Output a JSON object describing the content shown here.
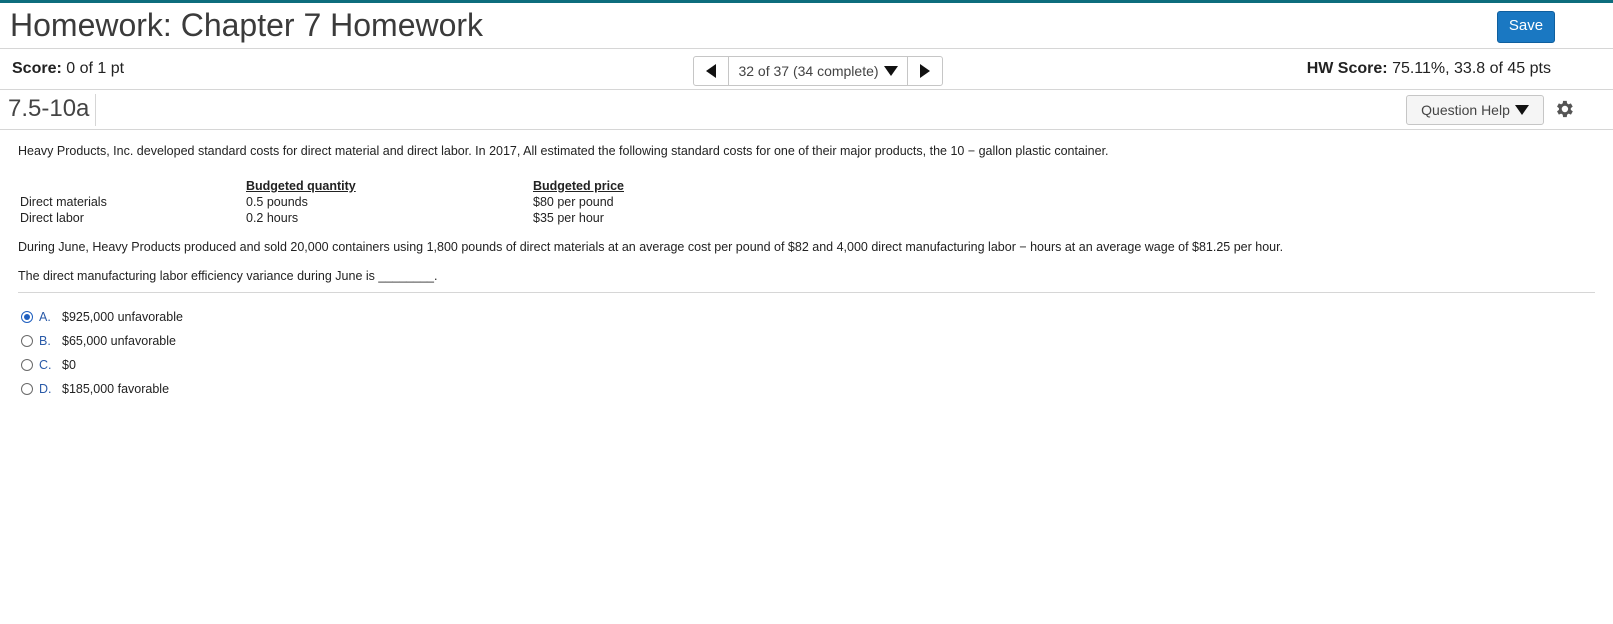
{
  "header": {
    "title": "Homework: Chapter 7 Homework",
    "save_label": "Save"
  },
  "scorebar": {
    "score_label": "Score:",
    "score_value": "0 of 1 pt",
    "nav_text": "32 of 37 (34 complete)",
    "hw_label": "HW Score:",
    "hw_value": "75.11%, 33.8 of 45 pts"
  },
  "question_bar": {
    "id": "7.5-10a",
    "help_label": "Question Help"
  },
  "content": {
    "intro": "Heavy Products, Inc. developed standard costs for direct material and direct labor. In 2017, All estimated the following standard costs for one of their major products, the 10 − gallon plastic container.",
    "table": {
      "headers": [
        "",
        "Budgeted quantity",
        "Budgeted price"
      ],
      "rows": [
        [
          "Direct materials",
          "0.5 pounds",
          "$80 per pound"
        ],
        [
          "Direct labor",
          "0.2 hours",
          "$35 per hour"
        ]
      ]
    },
    "paragraph": "During June, Heavy Products produced and sold 20,000 containers using 1,800 pounds of direct materials at an average cost per pound of $82 and 4,000 direct manufacturing labor − hours at an average wage of $81.25 per hour.",
    "question": "The direct manufacturing labor efficiency variance during June is ________."
  },
  "choices": [
    {
      "letter": "A.",
      "text": "$925,000 unfavorable",
      "selected": true
    },
    {
      "letter": "B.",
      "text": "$65,000 unfavorable",
      "selected": false
    },
    {
      "letter": "C.",
      "text": "$0",
      "selected": false
    },
    {
      "letter": "D.",
      "text": "$185,000 favorable",
      "selected": false
    }
  ],
  "colors": {
    "accent": "#1a78c2",
    "top_bar": "#0d6d7d",
    "radio_selected": "#1f5fbf"
  },
  "icons": {
    "prev": "triangle-left-icon",
    "next": "triangle-right-icon",
    "dropdown": "triangle-down-icon",
    "settings": "gear-icon"
  }
}
